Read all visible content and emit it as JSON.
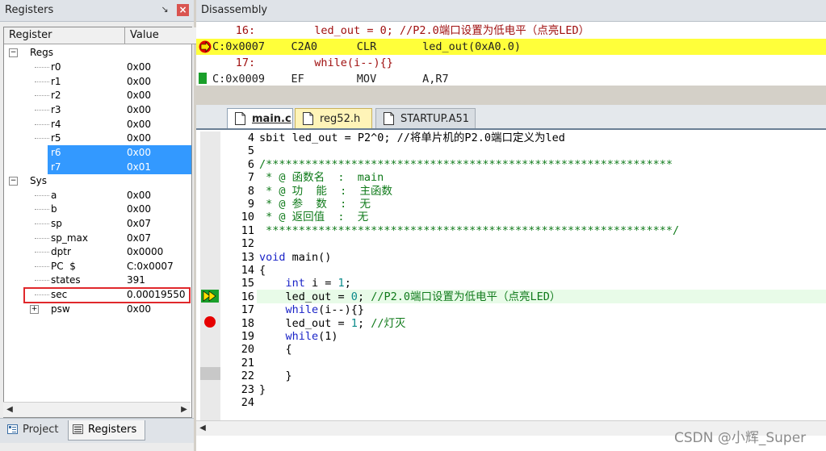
{
  "registers_panel": {
    "title": "Registers",
    "pin": "↘",
    "close": "×",
    "columns": [
      "Register",
      "Value"
    ],
    "groups": [
      {
        "name": "Regs",
        "expander": "−"
      },
      {
        "name": "Sys",
        "expander": "−"
      }
    ],
    "regs": [
      {
        "name": "r0",
        "value": "0x00"
      },
      {
        "name": "r1",
        "value": "0x00"
      },
      {
        "name": "r2",
        "value": "0x00"
      },
      {
        "name": "r3",
        "value": "0x00"
      },
      {
        "name": "r4",
        "value": "0x00"
      },
      {
        "name": "r5",
        "value": "0x00"
      },
      {
        "name": "r6",
        "value": "0x00"
      },
      {
        "name": "r7",
        "value": "0x01"
      }
    ],
    "sys": [
      {
        "name": "a",
        "value": "0x00"
      },
      {
        "name": "b",
        "value": "0x00"
      },
      {
        "name": "sp",
        "value": "0x07"
      },
      {
        "name": "sp_max",
        "value": "0x07"
      },
      {
        "name": "dptr",
        "value": "0x0000"
      },
      {
        "name": "PC  $",
        "value": "C:0x0007"
      },
      {
        "name": "states",
        "value": "391"
      },
      {
        "name": "sec",
        "value": "0.00019550"
      },
      {
        "name": "psw",
        "value": "0x00",
        "expander": "+"
      }
    ],
    "scroll_left": "◀",
    "scroll_right": "▶",
    "tabs": {
      "project": "Project",
      "registers": "Registers"
    }
  },
  "disassembly": {
    "title": "Disassembly",
    "lines": [
      {
        "text": "      16:         led_out = 0; //P2.0端口设置为低电平（点亮LED）"
      },
      {
        "text": "C:0x0007    C2A0      CLR       led_out(0xA0.0)"
      },
      {
        "text": "      17:         while(i--){}"
      },
      {
        "text": "C:0x0009    EF        MOV       A,R7"
      }
    ]
  },
  "editor": {
    "tabs": [
      "main.c",
      "reg52.h",
      "STARTUP.A51"
    ],
    "line_numbers": [
      "4",
      "5",
      "6",
      "7",
      "8",
      "9",
      "10",
      "11",
      "12",
      "13",
      "14",
      "15",
      "16",
      "17",
      "18",
      "19",
      "20",
      "21",
      "22",
      "23",
      "24"
    ],
    "lines": {
      "l4": "sbit led_out = P2^0; //将单片机的P2.0端口定义为led",
      "l6": "/**************************************************************",
      "l7": " * @ 函数名  :  main",
      "l8": " * @ 功  能  :  主函数",
      "l9": " * @ 参  数  :  无",
      "l10": " * @ 返回值  :  无",
      "l11": " **************************************************************/",
      "l13_kw": "void",
      "l13_rest": " main()",
      "l14": "{",
      "l15_kw": "    int",
      "l15_a": " i = ",
      "l15_n": "1",
      "l15_b": ";",
      "l16_a": "    led_out = ",
      "l16_n": "0",
      "l16_b": "; ",
      "l16_c": "//P2.0端口设置为低电平（点亮LED）",
      "l17_kw": "    while",
      "l17_rest": "(i--){}",
      "l18_a": "    led_out = ",
      "l18_n": "1",
      "l18_b": "; ",
      "l18_c": "//灯灭",
      "l19_kw": "    while",
      "l19_rest": "(1)",
      "l20": "    {",
      "l22": "    }",
      "l23": "}"
    }
  },
  "watermark": "CSDN @小辉_Super"
}
